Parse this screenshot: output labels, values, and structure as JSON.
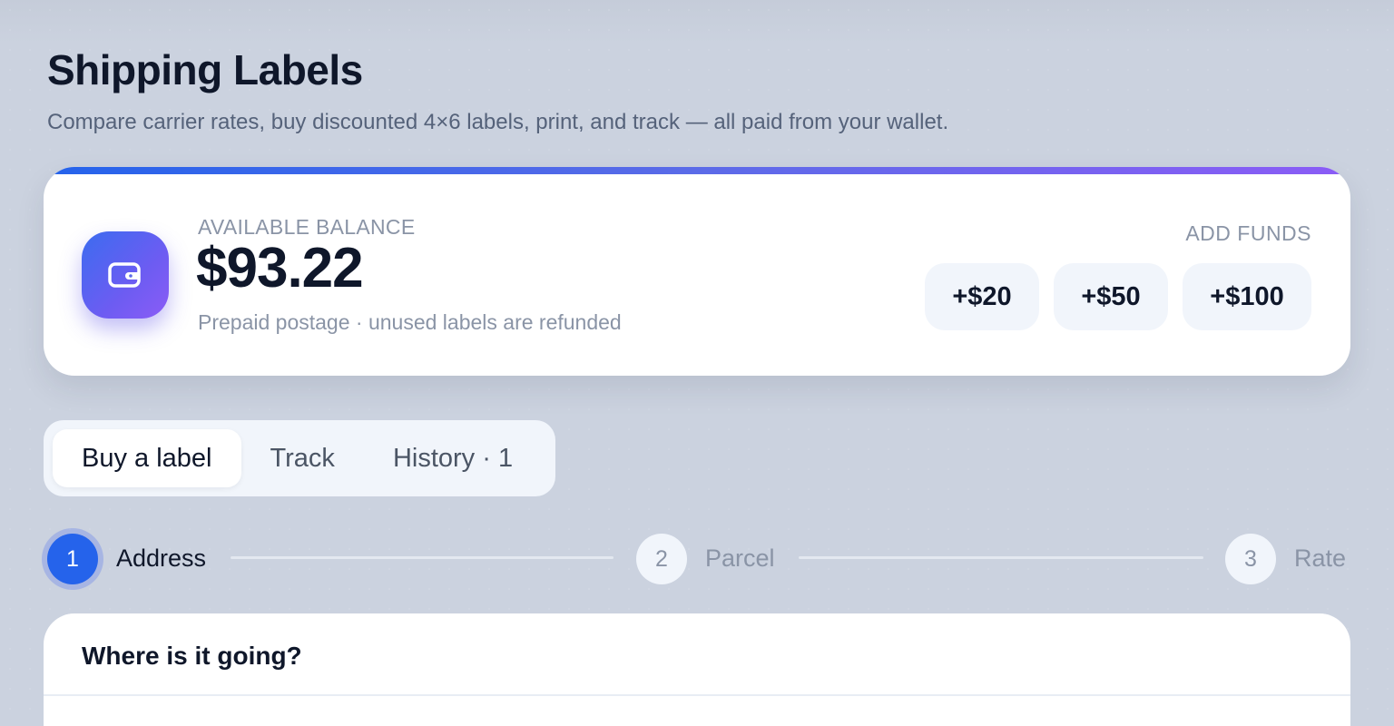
{
  "header": {
    "title": "Shipping Labels",
    "subtitle": "Compare carrier rates, buy discounted 4×6 labels, print, and track — all paid from your wallet."
  },
  "wallet": {
    "icon": "wallet-icon",
    "caption": "AVAILABLE BALANCE",
    "balance": "$93.22",
    "note": "Prepaid postage · unused labels are refunded",
    "add_funds_label": "ADD FUNDS",
    "fund_options": [
      "+$20",
      "+$50",
      "+$100"
    ]
  },
  "tabs": [
    {
      "label": "Buy a label",
      "active": true
    },
    {
      "label": "Track",
      "active": false
    },
    {
      "label": "History · 1",
      "active": false
    }
  ],
  "stepper": [
    {
      "number": "1",
      "label": "Address",
      "active": true
    },
    {
      "number": "2",
      "label": "Parcel",
      "active": false
    },
    {
      "number": "3",
      "label": "Rate",
      "active": false
    }
  ],
  "address_form": {
    "title": "Where is it going?"
  },
  "colors": {
    "accent": "#2563eb",
    "accent_gradient_end": "#8b5cf6",
    "background": "#cbd2df"
  }
}
